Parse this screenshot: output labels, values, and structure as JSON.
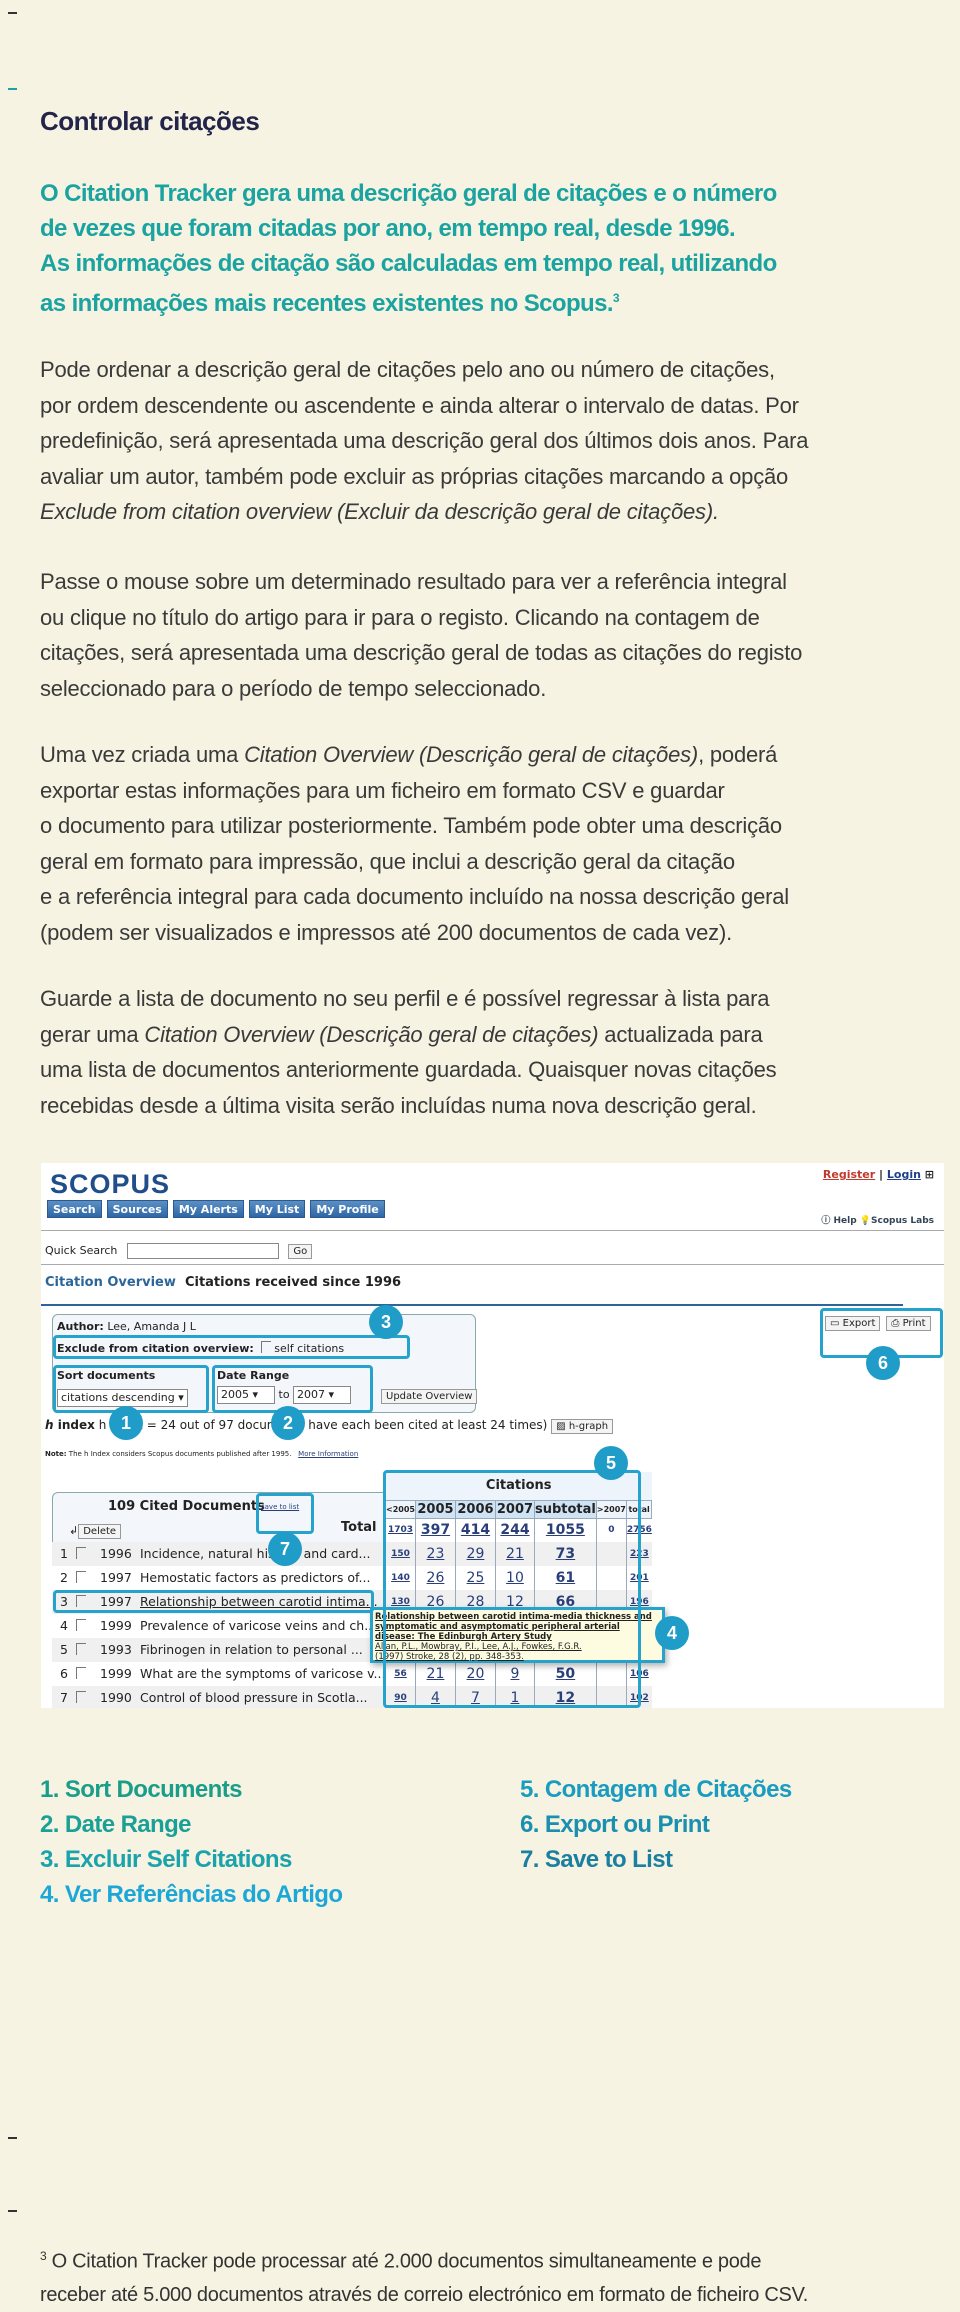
{
  "colors": {
    "background": "#f7f3e2",
    "title": "#22244a",
    "lead": "#1aa3a0",
    "badge": "#1f9cc7",
    "highlight_box": "#25a3cc"
  },
  "title": "Controlar citações",
  "lead": [
    "O Citation Tracker gera uma descrição geral de citações e o número",
    "de vezes que foram citadas por ano, em tempo real, desde 1996.",
    "As informações de citação são calculadas em tempo real, utilizando",
    "as informações mais recentes existentes no Scopus."
  ],
  "lead_sup": "3",
  "paragraphs": [
    [
      [
        {
          "t": "Pode ordenar a descrição geral de citações pelo ano ou número de citações,"
        }
      ],
      [
        {
          "t": "por ordem descendente ou ascendente e ainda alterar o intervalo de datas. Por"
        }
      ],
      [
        {
          "t": "predefinição, será apresentada uma descrição geral dos últimos dois anos. Para"
        }
      ],
      [
        {
          "t": "avaliar um autor, também pode excluir as próprias citações marcando a opção"
        }
      ],
      [
        {
          "t": "Exclude from citation overview (Excluir da descrição geral de citações).",
          "i": true
        }
      ]
    ],
    [
      [
        {
          "t": "Passe o mouse sobre um determinado resultado para ver a referência integral"
        }
      ],
      [
        {
          "t": "ou clique no título do artigo para ir para o registo. Clicando na contagem de"
        }
      ],
      [
        {
          "t": "citações, será apresentada uma descrição geral de todas as citações do registo"
        }
      ],
      [
        {
          "t": "seleccionado para o período de tempo seleccionado."
        }
      ]
    ],
    [
      [
        {
          "t": "Uma vez criada uma "
        },
        {
          "t": "Citation Overview (Descrição geral de citações)",
          "i": true
        },
        {
          "t": ", poderá"
        }
      ],
      [
        {
          "t": "exportar estas informações para um ficheiro em formato CSV e guardar"
        }
      ],
      [
        {
          "t": "o documento para utilizar posteriormente. Também pode obter uma descrição"
        }
      ],
      [
        {
          "t": "geral em formato para impressão, que inclui a descrição geral da citação"
        }
      ],
      [
        {
          "t": "e a referência integral para cada documento incluído na nossa descrição geral"
        }
      ],
      [
        {
          "t": "(podem ser visualizados e impressos até 200 documentos de cada vez)."
        }
      ]
    ],
    [
      [
        {
          "t": "Guarde a lista de documento no seu perfil e é possível regressar à lista para"
        }
      ],
      [
        {
          "t": "gerar uma "
        },
        {
          "t": "Citation Overview (Descrição geral de citações)",
          "i": true
        },
        {
          "t": " actualizada para"
        }
      ],
      [
        {
          "t": "uma lista de documentos anteriormente guardada. Quaisquer novas citações"
        }
      ],
      [
        {
          "t": "recebidas desde a última visita serão incluídas numa nova descrição geral."
        }
      ]
    ]
  ],
  "legend": [
    {
      "label": "1. Sort Documents",
      "color": "#1a9e8a"
    },
    {
      "label": "2. Date Range",
      "color": "#1aa096"
    },
    {
      "label": "3. Excluir Self Citations",
      "color": "#1aa3ab"
    },
    {
      "label": "4. Ver Referências do Artigo",
      "color": "#1ba7d8"
    },
    {
      "label": "5. Contagem de Citações",
      "color": "#1a9cc0"
    },
    {
      "label": "6.  Export ou Print",
      "color": "#1a8fb0"
    },
    {
      "label": "7.  Save to List",
      "color": "#1a7fa0"
    }
  ],
  "footnote": {
    "sup": "3",
    "lines": [
      "O Citation Tracker pode processar até 2.000 documentos simultaneamente e pode",
      "receber até 5.000 documentos através de correio electrónico em formato de ficheiro CSV."
    ]
  },
  "screenshot": {
    "logo": "SCOPUS",
    "nav": [
      "Search",
      "Sources",
      "My Alerts",
      "My List",
      "My Profile"
    ],
    "register": "Register",
    "login": "Login",
    "help": "Help",
    "labs": "Scopus Labs",
    "quick_search_label": "Quick Search",
    "go": "Go",
    "overview_title": "Citation Overview",
    "overview_subtitle": "Citations received since 1996",
    "author_label": "Author:",
    "author": "Lee, Amanda J L",
    "exclude_label": "Exclude from citation overview:",
    "self_citations": "self citations",
    "sort_label": "Sort documents",
    "sort_value": "citations descending",
    "date_label": "Date Range",
    "date_from": "2005",
    "date_to_word": "to",
    "date_to": "2007",
    "update": "Update Overview",
    "export": "Export",
    "print": "Print",
    "h_index": "h index = 24 out of 97 documents have each been cited at least 24 times)",
    "h_graph": "h-graph",
    "note_label": "Note:",
    "note": "The h Index considers Scopus documents published after 1995.",
    "more_info": "More Information",
    "cited_docs": "109 Cited Documents",
    "save_to_list": "save to list",
    "delete": "Delete",
    "total": "Total",
    "rows": [
      {
        "n": "1",
        "year": "1996",
        "title": "Incidence, natural history and card..."
      },
      {
        "n": "2",
        "year": "1997",
        "title": "Hemostatic factors as predictors of..."
      },
      {
        "n": "3",
        "year": "1997",
        "title": "Relationship between carotid intima..."
      },
      {
        "n": "4",
        "year": "1999",
        "title": "Prevalence of varicose veins and ch..."
      },
      {
        "n": "5",
        "year": "1993",
        "title": "Fibrinogen in relation to personal ..."
      },
      {
        "n": "6",
        "year": "1999",
        "title": "What are the symptoms of varicose v..."
      },
      {
        "n": "7",
        "year": "1990",
        "title": "Control of blood pressure in Scotla..."
      }
    ],
    "citations_header": "Citations",
    "columns": [
      "<2005",
      "2005",
      "2006",
      "2007",
      "subtotal",
      ">2007",
      "total"
    ],
    "totals": [
      "1703",
      "397",
      "414",
      "244",
      "1055",
      "0",
      "2756"
    ],
    "cells": [
      [
        "150",
        "23",
        "29",
        "21",
        "73",
        "",
        "223"
      ],
      [
        "140",
        "26",
        "25",
        "10",
        "61",
        "",
        "201"
      ],
      [
        "130",
        "26",
        "28",
        "12",
        "66",
        "",
        "196"
      ],
      [
        "",
        "",
        "",
        "",
        "",
        "",
        ""
      ],
      [
        "",
        "",
        "",
        "",
        "",
        "",
        ""
      ],
      [
        "56",
        "21",
        "20",
        "9",
        "50",
        "",
        "106"
      ],
      [
        "90",
        "4",
        "7",
        "1",
        "12",
        "",
        "102"
      ]
    ],
    "tooltip": {
      "title": "Relationship between carotid intima-media thickness and symptomatic and asymptomatic peripheral arterial disease: The Edinburgh Artery Study",
      "authors": "Allan, P.L., Mowbray, P.I., Lee, A.J., Fowkes, F.G.R.",
      "source": "(1997) Stroke, 28 (2), pp. 348-353."
    },
    "badges": [
      "1",
      "2",
      "3",
      "4",
      "5",
      "6",
      "7"
    ]
  }
}
